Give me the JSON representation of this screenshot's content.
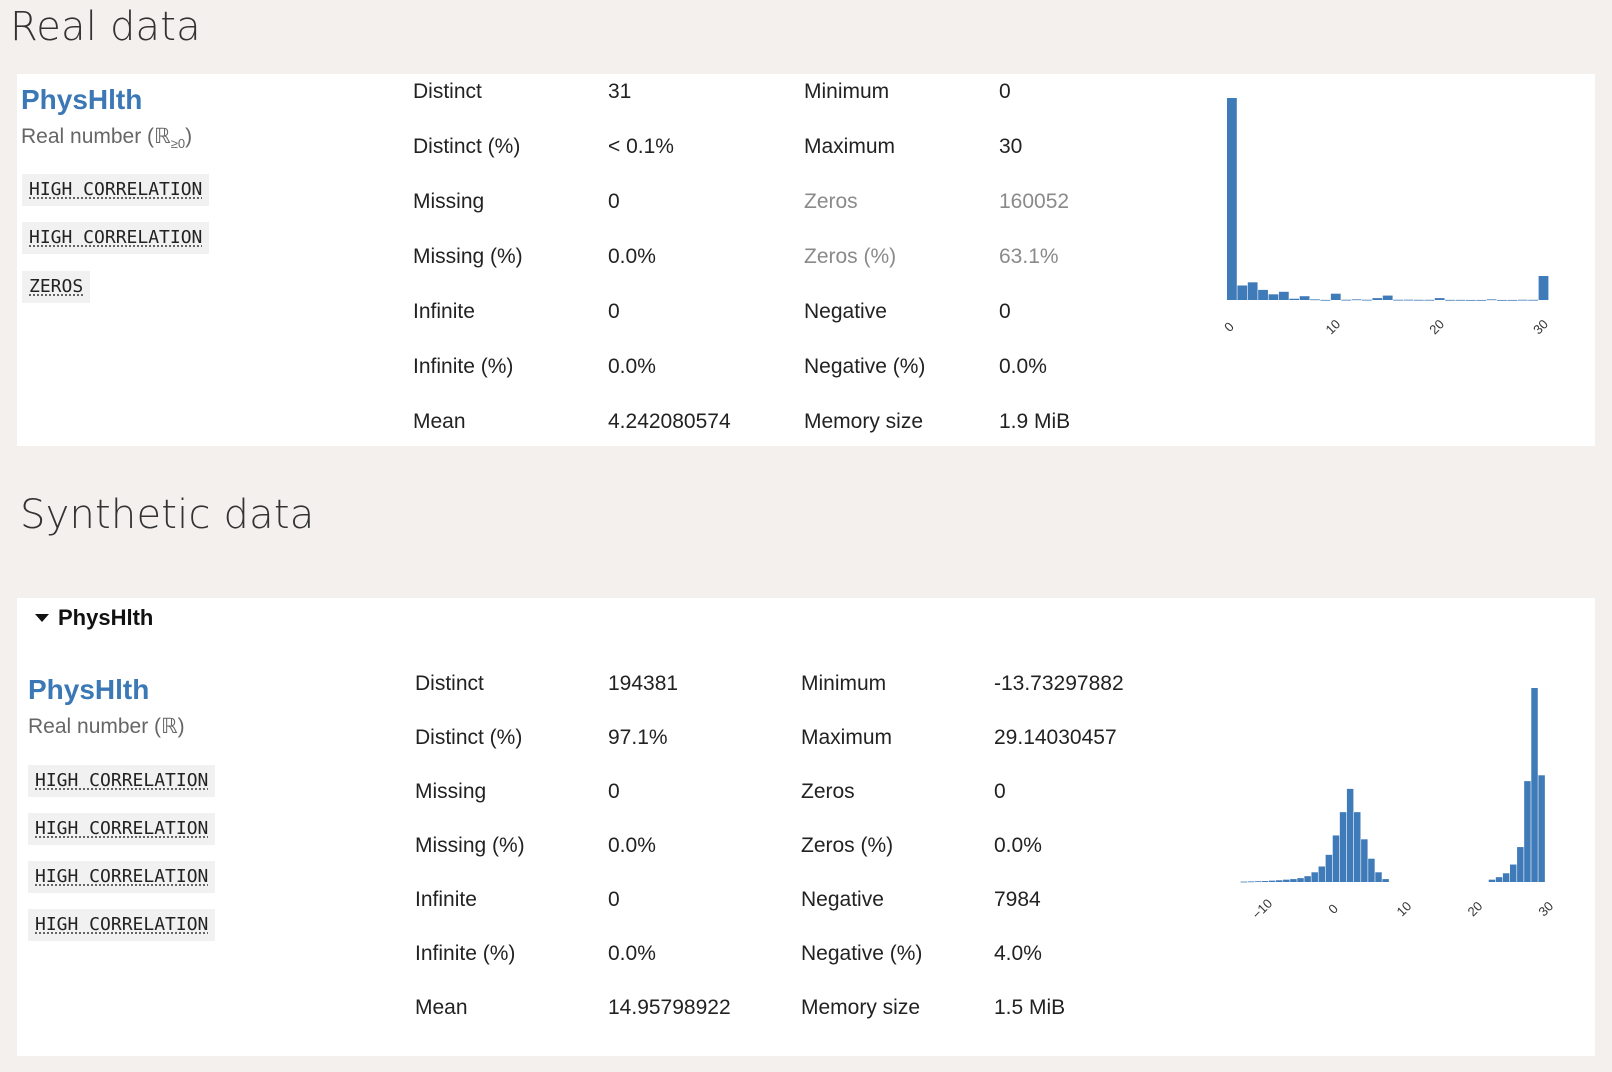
{
  "real": {
    "section_title": "Real data",
    "var_name": "PhysHlth",
    "type_label": "Real number (ℝ",
    "type_sub": "≥0",
    "type_close": ")",
    "badges": [
      "HIGH CORRELATION",
      "HIGH CORRELATION",
      "ZEROS"
    ],
    "stats_left": [
      {
        "label": "Distinct",
        "value": "31"
      },
      {
        "label": "Distinct (%)",
        "value": "< 0.1%"
      },
      {
        "label": "Missing",
        "value": "0"
      },
      {
        "label": "Missing (%)",
        "value": "0.0%"
      },
      {
        "label": "Infinite",
        "value": "0"
      },
      {
        "label": "Infinite (%)",
        "value": "0.0%"
      },
      {
        "label": "Mean",
        "value": "4.242080574"
      }
    ],
    "stats_right": [
      {
        "label": "Minimum",
        "value": "0"
      },
      {
        "label": "Maximum",
        "value": "30"
      },
      {
        "label": "Zeros",
        "value": "160052"
      },
      {
        "label": "Zeros (%)",
        "value": "63.1%"
      },
      {
        "label": "Negative",
        "value": "0"
      },
      {
        "label": "Negative (%)",
        "value": "0.0%"
      },
      {
        "label": "Memory size",
        "value": "1.9 MiB"
      }
    ]
  },
  "synthetic": {
    "section_title": "Synthetic data",
    "collapse_label": "PhysHlth",
    "var_name": "PhysHlth",
    "type_label": "Real number (ℝ)",
    "badges": [
      "HIGH CORRELATION",
      "HIGH CORRELATION",
      "HIGH CORRELATION",
      "HIGH CORRELATION"
    ],
    "stats_left": [
      {
        "label": "Distinct",
        "value": "194381"
      },
      {
        "label": "Distinct (%)",
        "value": "97.1%"
      },
      {
        "label": "Missing",
        "value": "0"
      },
      {
        "label": "Missing (%)",
        "value": "0.0%"
      },
      {
        "label": "Infinite",
        "value": "0"
      },
      {
        "label": "Infinite (%)",
        "value": "0.0%"
      },
      {
        "label": "Mean",
        "value": "14.95798922"
      }
    ],
    "stats_right": [
      {
        "label": "Minimum",
        "value": "-13.73297882"
      },
      {
        "label": "Maximum",
        "value": "29.14030457"
      },
      {
        "label": "Zeros",
        "value": "0"
      },
      {
        "label": "Zeros (%)",
        "value": "0.0%"
      },
      {
        "label": "Negative",
        "value": "7984"
      },
      {
        "label": "Negative (%)",
        "value": "4.0%"
      },
      {
        "label": "Memory size",
        "value": "1.5 MiB"
      }
    ]
  },
  "colors": {
    "accent": "#3b78b5",
    "bar": "#3f7bb8",
    "muted": "#8a8a8a"
  },
  "chart_data": [
    {
      "type": "bar",
      "x": [
        0,
        1,
        2,
        3,
        4,
        5,
        6,
        7,
        8,
        9,
        10,
        11,
        12,
        13,
        14,
        15,
        16,
        17,
        18,
        19,
        20,
        21,
        22,
        23,
        24,
        25,
        26,
        27,
        28,
        29,
        30
      ],
      "values": [
        160052,
        11500,
        14000,
        8000,
        4500,
        6500,
        1000,
        3000,
        500,
        100,
        5000,
        200,
        500,
        200,
        1500,
        3500,
        200,
        250,
        150,
        150,
        1500,
        100,
        100,
        50,
        50,
        500,
        50,
        50,
        200,
        150,
        19000
      ],
      "xticks": [
        "0",
        "10",
        "20",
        "30"
      ],
      "xlim": [
        -0.5,
        30.5
      ],
      "grid": false
    },
    {
      "type": "bar",
      "x": [
        -13,
        -12,
        -11,
        -10,
        -9,
        -8,
        -7,
        -6,
        -5,
        -4,
        -3,
        -2,
        -1,
        0,
        1,
        2,
        3,
        4,
        5,
        6,
        7,
        22,
        23,
        24,
        25,
        26,
        27,
        28,
        29
      ],
      "values": [
        200,
        300,
        400,
        500,
        700,
        900,
        1200,
        1500,
        2000,
        3000,
        5000,
        8000,
        14000,
        24000,
        36000,
        48000,
        36000,
        22000,
        12000,
        5000,
        1500,
        1200,
        2500,
        4500,
        9000,
        18000,
        52000,
        100000,
        55000
      ],
      "xticks": [
        "−10",
        "0",
        "10",
        "20",
        "30"
      ],
      "xlim": [
        -14,
        30
      ],
      "grid": false
    }
  ]
}
